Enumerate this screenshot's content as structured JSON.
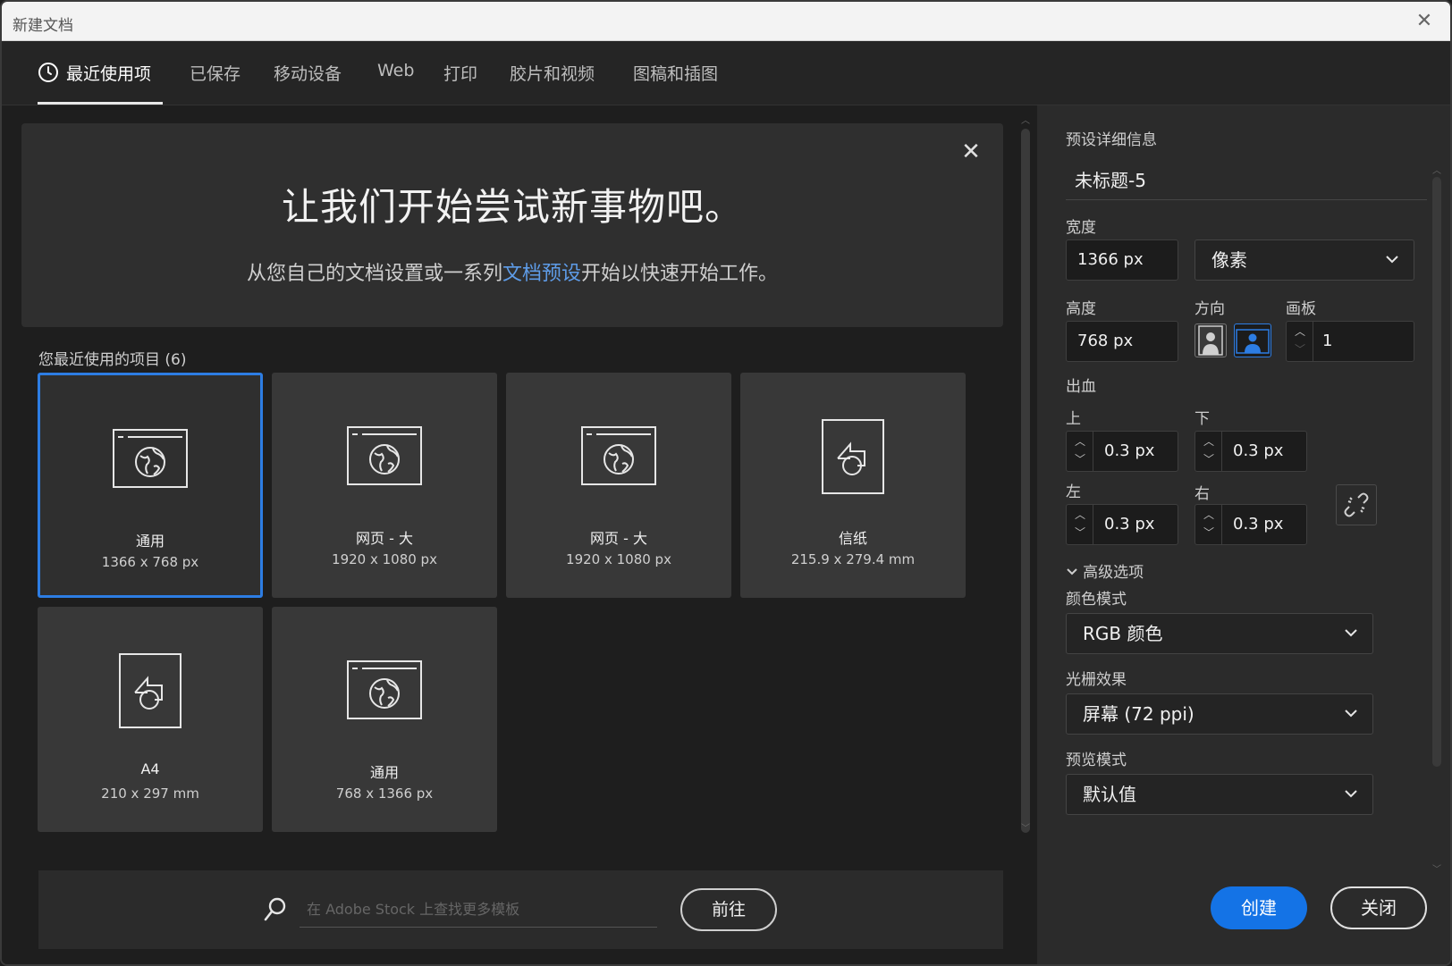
{
  "window": {
    "title": "新建文档",
    "close_icon": "close-icon"
  },
  "tabs": [
    {
      "label": "最近使用项",
      "icon": "clock-icon",
      "active": true
    },
    {
      "label": "已保存"
    },
    {
      "label": "移动设备"
    },
    {
      "label": "Web"
    },
    {
      "label": "打印"
    },
    {
      "label": "胶片和视频"
    },
    {
      "label": "图稿和插图"
    }
  ],
  "hero": {
    "headline": "让我们开始尝试新事物吧。",
    "text_before": "从您自己的文档设置或一系列",
    "link": "文档预设",
    "text_after": "开始以快速开始工作。"
  },
  "recent": {
    "label": "您最近使用的项目 (6)",
    "items": [
      {
        "name": "通用",
        "dims": "1366 x 768 px",
        "icon": "web-document-icon",
        "selected": true
      },
      {
        "name": "网页 - 大",
        "dims": "1920 x 1080 px",
        "icon": "web-document-icon"
      },
      {
        "name": "网页 - 大",
        "dims": "1920 x 1080 px",
        "icon": "web-document-icon"
      },
      {
        "name": "信纸",
        "dims": "215.9 x 279.4 mm",
        "icon": "print-document-icon"
      },
      {
        "name": "A4",
        "dims": "210 x 297 mm",
        "icon": "print-document-icon"
      },
      {
        "name": "通用",
        "dims": "768 x 1366 px",
        "icon": "web-document-icon"
      }
    ]
  },
  "stock": {
    "placeholder": "在 Adobe Stock 上查找更多模板",
    "go_label": "前往"
  },
  "preset": {
    "header": "预设详细信息",
    "doc_title": "未标题-5",
    "width_label": "宽度",
    "width_value": "1366 px",
    "unit_value": "像素",
    "height_label": "高度",
    "height_value": "768 px",
    "orientation_label": "方向",
    "orientation_selected": "landscape",
    "artboard_label": "画板",
    "artboard_value": "1",
    "bleed_label": "出血",
    "top_label": "上",
    "top_value": "0.3 px",
    "bottom_label": "下",
    "bottom_value": "0.3 px",
    "left_label": "左",
    "left_value": "0.3 px",
    "right_label": "右",
    "right_value": "0.3 px",
    "advanced_label": "高级选项",
    "color_mode_label": "颜色模式",
    "color_mode_value": "RGB 颜色",
    "raster_label": "光栅效果",
    "raster_value": "屏幕 (72 ppi)",
    "preview_label": "预览模式",
    "preview_value": "默认值",
    "create_label": "创建",
    "close_label": "关闭"
  },
  "colors": {
    "accent": "#1473e6",
    "link": "#5e9ce8",
    "selected_border": "#2d7de3"
  }
}
